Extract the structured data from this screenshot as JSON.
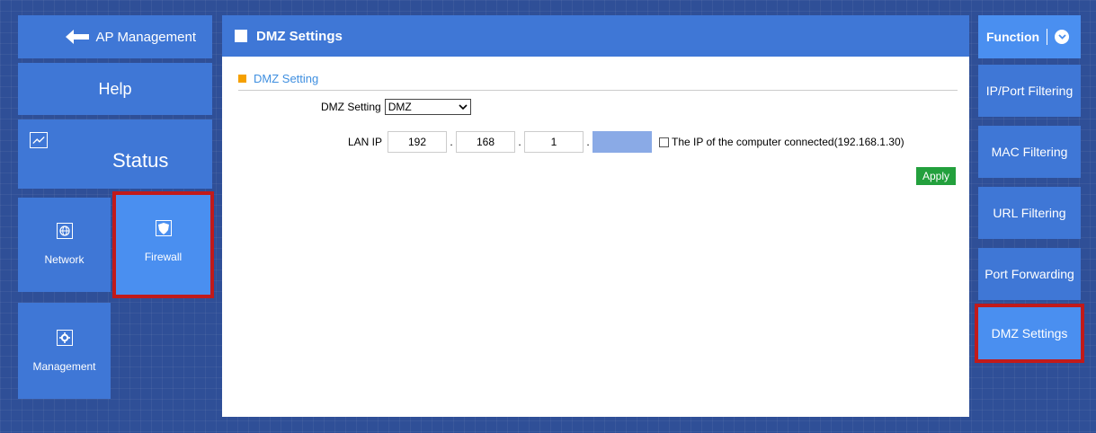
{
  "left_nav": {
    "ap_management": "AP Management",
    "help": "Help",
    "status": "Status",
    "network": "Network",
    "firewall": "Firewall",
    "management": "Management"
  },
  "header": {
    "title": "DMZ Settings"
  },
  "dmz": {
    "section_title": "DMZ Setting",
    "setting_label": "DMZ Setting",
    "setting_value": "DMZ",
    "lan_ip_label": "LAN IP",
    "ip": [
      "192",
      "168",
      "1",
      ""
    ],
    "checkbox_label": "The IP of the computer connected(192.168.1.30)",
    "apply": "Apply"
  },
  "right_nav": {
    "function": "Function",
    "items": [
      "IP/Port Filtering",
      "MAC Filtering",
      "URL Filtering",
      "Port Forwarding",
      "DMZ Settings"
    ]
  },
  "colors": {
    "background": "#2f4f97",
    "tile": "#3f77d6",
    "active_tile": "#4a8ff0",
    "highlight": "#c11a1a",
    "apply": "#23a03d",
    "section_bullet": "#f5a000"
  }
}
